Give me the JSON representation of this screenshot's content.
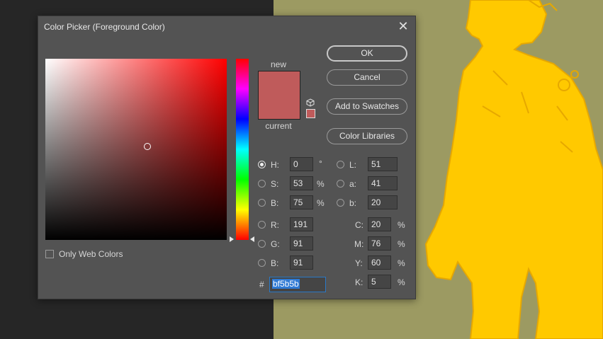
{
  "dialog": {
    "title": "Color Picker (Foreground Color)",
    "close_glyph": "✕"
  },
  "swatches": {
    "new_label": "new",
    "current_label": "current",
    "new_color": "#bf5b5b",
    "current_color": "#bf5b5b"
  },
  "buttons": {
    "ok": "OK",
    "cancel": "Cancel",
    "add_to_swatches": "Add to Swatches",
    "color_libraries": "Color Libraries"
  },
  "hsb": {
    "h_label": "H:",
    "h_value": "0",
    "h_unit": "°",
    "s_label": "S:",
    "s_value": "53",
    "s_unit": "%",
    "b_label": "B:",
    "b_value": "75",
    "b_unit": "%"
  },
  "lab": {
    "l_label": "L:",
    "l_value": "51",
    "a_label": "a:",
    "a_value": "41",
    "b_label": "b:",
    "b_value": "20"
  },
  "rgb": {
    "r_label": "R:",
    "r_value": "191",
    "g_label": "G:",
    "g_value": "91",
    "b_label": "B:",
    "b_value": "91"
  },
  "cmyk": {
    "c_label": "C:",
    "c_value": "20",
    "m_label": "M:",
    "m_value": "76",
    "y_label": "Y:",
    "y_value": "60",
    "k_label": "K:",
    "k_value": "5",
    "unit": "%"
  },
  "hex": {
    "label": "#",
    "value": "bf5b5b"
  },
  "options": {
    "only_web_colors": "Only Web Colors",
    "only_web_colors_checked": false
  },
  "colors": {
    "dialog_bg": "#535353",
    "selected_color": "#bf5b5b",
    "accent_blue": "#2f7ad4",
    "canvas_bg": "#9c9a62",
    "character_yellow": "#ffc900"
  }
}
